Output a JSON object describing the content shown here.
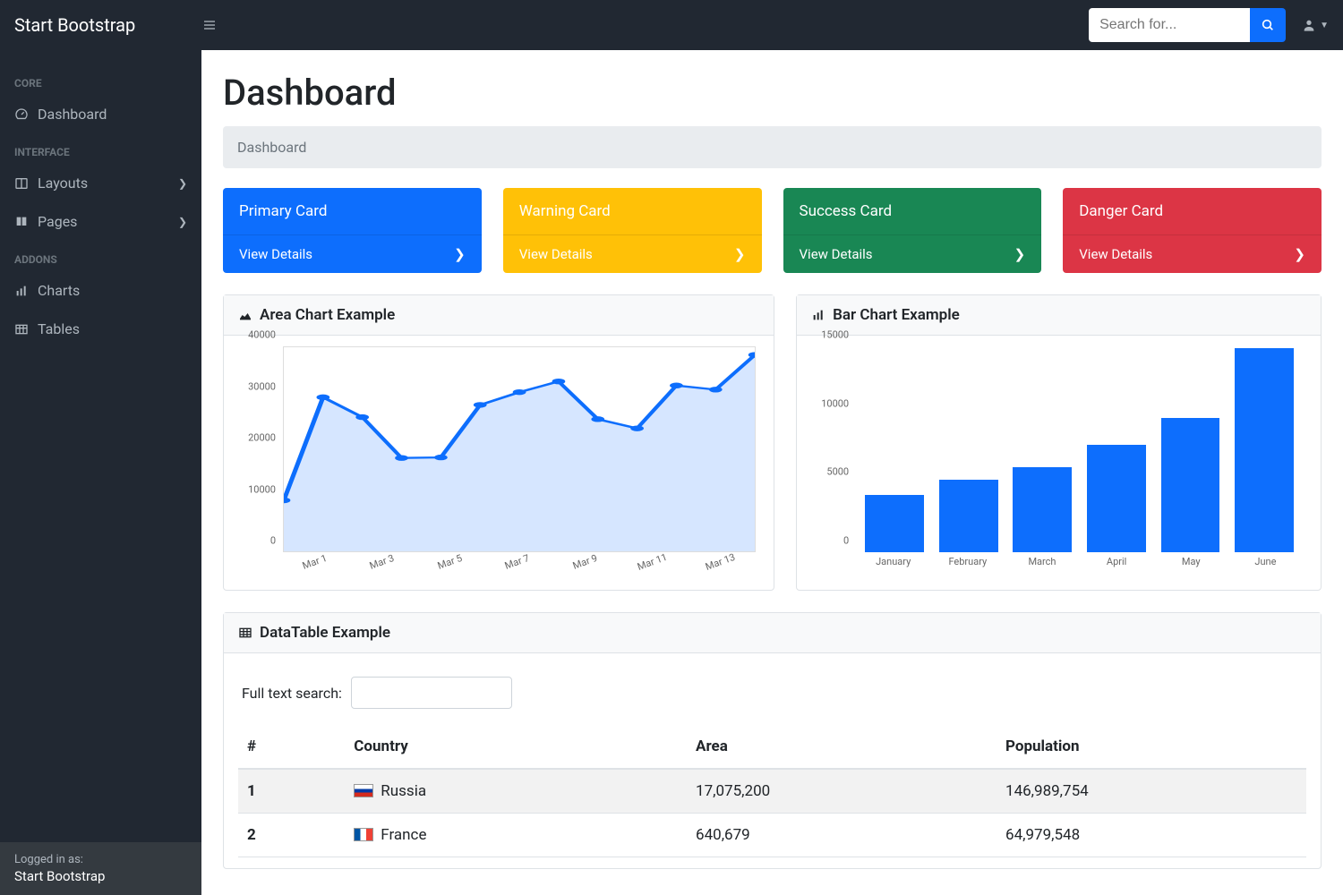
{
  "brand": "Start Bootstrap",
  "search": {
    "placeholder": "Search for..."
  },
  "sidebar": {
    "section_core": "CORE",
    "section_interface": "INTERFACE",
    "section_addons": "ADDONS",
    "dashboard": "Dashboard",
    "layouts": "Layouts",
    "pages": "Pages",
    "charts": "Charts",
    "tables": "Tables",
    "footer_label": "Logged in as:",
    "footer_user": "Start Bootstrap"
  },
  "page": {
    "title": "Dashboard",
    "breadcrumb": "Dashboard"
  },
  "cards": {
    "primary": {
      "title": "Primary Card",
      "link": "View Details"
    },
    "warning": {
      "title": "Warning Card",
      "link": "View Details"
    },
    "success": {
      "title": "Success Card",
      "link": "View Details"
    },
    "danger": {
      "title": "Danger Card",
      "link": "View Details"
    }
  },
  "panels": {
    "area_title": "Area Chart Example",
    "bar_title": "Bar Chart Example",
    "table_title": "DataTable Example",
    "search_label": "Full text search:"
  },
  "table": {
    "headers": {
      "idx": "#",
      "country": "Country",
      "area": "Area",
      "population": "Population"
    },
    "rows": [
      {
        "idx": "1",
        "country": "Russia",
        "area": "17,075,200",
        "population": "146,989,754",
        "flag": "ru"
      },
      {
        "idx": "2",
        "country": "France",
        "area": "640,679",
        "population": "64,979,548",
        "flag": "fr"
      }
    ]
  },
  "chart_data": [
    {
      "type": "area",
      "title": "Area Chart Example",
      "x": [
        "Mar 1",
        "Mar 2",
        "Mar 3",
        "Mar 4",
        "Mar 5",
        "Mar 6",
        "Mar 7",
        "Mar 8",
        "Mar 9",
        "Mar 10",
        "Mar 11",
        "Mar 12",
        "Mar 13"
      ],
      "x_ticks_shown": [
        "Mar 1",
        "Mar 3",
        "Mar 5",
        "Mar 7",
        "Mar 9",
        "Mar 11",
        "Mar 13"
      ],
      "values": [
        10000,
        30200,
        26300,
        18300,
        18400,
        28700,
        31200,
        33300,
        25900,
        24100,
        32500,
        31700,
        38500
      ],
      "ylabel": "",
      "ylim": [
        0,
        40000
      ],
      "y_ticks": [
        0,
        10000,
        20000,
        30000,
        40000
      ]
    },
    {
      "type": "bar",
      "title": "Bar Chart Example",
      "categories": [
        "January",
        "February",
        "March",
        "April",
        "May",
        "June"
      ],
      "values": [
        4200,
        5300,
        6200,
        7800,
        9800,
        14900
      ],
      "ylabel": "",
      "ylim": [
        0,
        15000
      ],
      "y_ticks": [
        0,
        5000,
        10000,
        15000
      ]
    }
  ]
}
